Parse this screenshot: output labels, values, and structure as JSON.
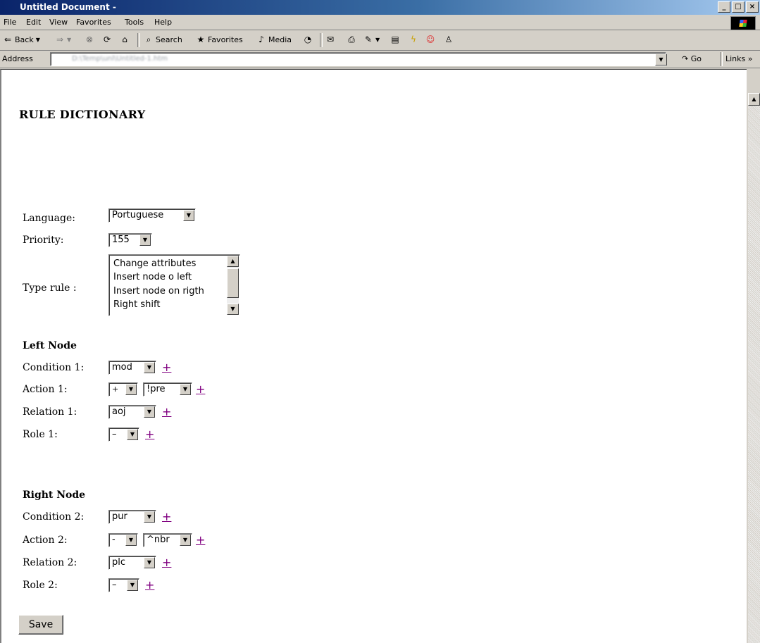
{
  "window": {
    "title": "Untitled Document -",
    "controls": [
      "_",
      "□",
      "×"
    ]
  },
  "menu": [
    "File",
    "Edit",
    "View",
    "Favorites",
    "Tools",
    "Help"
  ],
  "toolbar": {
    "back": "Back",
    "search": "Search",
    "favorites": "Favorites",
    "media": "Media"
  },
  "address": {
    "label": "Address",
    "value": "D:\\Temp\\unl\\Untitled-1.htm",
    "go": "Go",
    "links": "Links"
  },
  "page": {
    "title": "RULE DICTIONARY",
    "language": {
      "label": "Language:",
      "value": "Portuguese"
    },
    "priority": {
      "label": "Priority:",
      "value": "155"
    },
    "type_rule": {
      "label": "Type rule :",
      "options": [
        "Change attributes",
        "Insert node o left",
        "Insert node on rigth",
        "Right shift"
      ]
    },
    "left": {
      "heading": "Left Node",
      "condition": {
        "label": "Condition 1:",
        "value": "mod"
      },
      "action": {
        "label": "Action 1:",
        "value1": "+",
        "value2": "!pre"
      },
      "relation": {
        "label": "Relation 1:",
        "value": "aoj"
      },
      "role": {
        "label": "Role 1:",
        "value": "–"
      }
    },
    "right": {
      "heading": "Right Node",
      "condition": {
        "label": "Condition 2:",
        "value": "pur"
      },
      "action": {
        "label": "Action 2:",
        "value1": "-",
        "value2": "^nbr"
      },
      "relation": {
        "label": "Relation 2:",
        "value": "plc"
      },
      "role": {
        "label": "Role 2:",
        "value": "–"
      }
    },
    "plus": "+",
    "save": "Save"
  }
}
